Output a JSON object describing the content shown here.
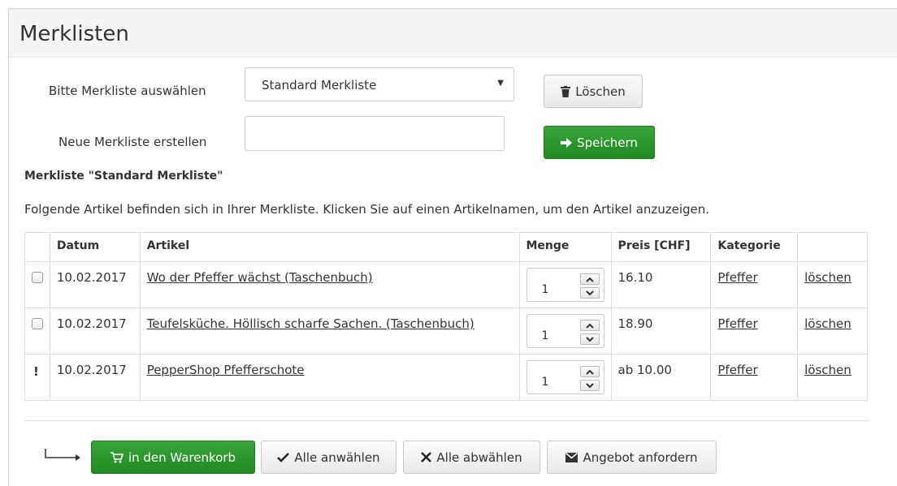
{
  "page": {
    "title": "Merklisten"
  },
  "select_list": {
    "label": "Bitte Merkliste auswählen",
    "value": "Standard Merkliste",
    "delete_label": "Löschen"
  },
  "new_list": {
    "label": "Neue Merkliste erstellen",
    "value": "",
    "save_label": "Speichern"
  },
  "list": {
    "heading": "Merkliste \"Standard Merkliste\"",
    "description": "Folgende Artikel befinden sich in Ihrer Merkliste. Klicken Sie auf einen Artikelnamen, um den Artikel anzuzeigen."
  },
  "table": {
    "headers": {
      "date": "Datum",
      "article": "Artikel",
      "qty": "Menge",
      "price": "Preis [CHF]",
      "category": "Kategorie"
    },
    "rows": [
      {
        "marker": "checkbox",
        "date": "10.02.2017",
        "article": "Wo der Pfeffer wächst (Taschenbuch)",
        "qty": "1",
        "price": "16.10",
        "category": "Pfeffer",
        "delete": "löschen"
      },
      {
        "marker": "checkbox",
        "date": "10.02.2017",
        "article": "Teufelsküche. Höllisch scharfe Sachen. (Taschenbuch)",
        "qty": "1",
        "price": "18.90",
        "category": "Pfeffer",
        "delete": "löschen"
      },
      {
        "marker": "!",
        "date": "10.02.2017",
        "article": "PepperShop Pfefferschote",
        "qty": "1",
        "price": "ab 10.00",
        "category": "Pfeffer",
        "delete": "löschen"
      }
    ]
  },
  "actions": {
    "cart": "in den Warenkorb",
    "select_all": "Alle anwählen",
    "deselect_all": "Alle abwählen",
    "request_offer": "Angebot anfordern"
  },
  "colors": {
    "accent_green": "#2a9a2a",
    "border": "#dddddd"
  }
}
